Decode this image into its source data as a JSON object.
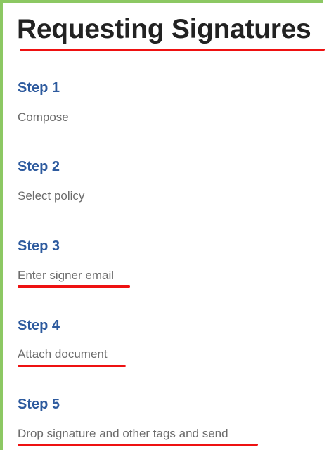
{
  "title": "Requesting Signatures",
  "steps": [
    {
      "heading": "Step 1",
      "description": "Compose",
      "underlined": false
    },
    {
      "heading": "Step 2",
      "description": "Select policy",
      "underlined": false
    },
    {
      "heading": "Step 3",
      "description": "Enter signer email",
      "underlined": true
    },
    {
      "heading": "Step 4",
      "description": "Attach document",
      "underlined": true
    },
    {
      "heading": "Step 5",
      "description": "Drop signature and other tags and send",
      "underlined": true
    }
  ],
  "colors": {
    "frame_border": "#8cc863",
    "highlight_underline": "#ee1111",
    "step_heading": "#2d5a9e",
    "title_text": "#222222",
    "description_text": "#6b6b6b"
  }
}
